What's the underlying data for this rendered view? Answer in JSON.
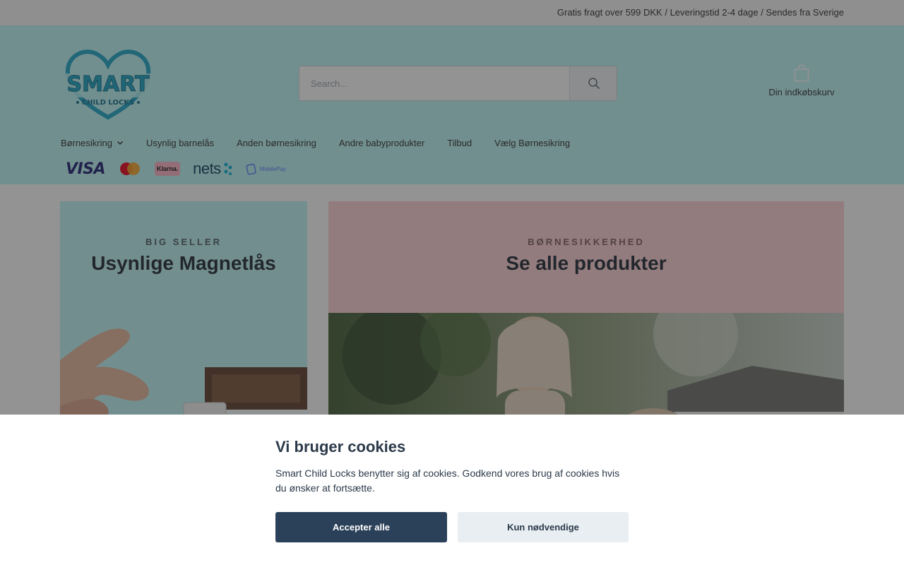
{
  "topbar": {
    "shipping_text": "Gratis fragt over 599 DKK / Leveringstid 2-4 dage / Sendes fra Sverige"
  },
  "header": {
    "logo": {
      "line1": "SMART",
      "line2": "CHILD LOCKS"
    },
    "search": {
      "placeholder": "Search..."
    },
    "cart": {
      "label": "Din indkøbskurv"
    }
  },
  "nav": {
    "items": [
      {
        "label": "Børnesikring",
        "has_dropdown": true
      },
      {
        "label": "Usynlig barnelås"
      },
      {
        "label": "Anden børnesikring"
      },
      {
        "label": "Andre babyprodukter"
      },
      {
        "label": "Tilbud"
      },
      {
        "label": "Vælg Børnesikring"
      }
    ]
  },
  "payments": {
    "visa": "VISA",
    "klarna": "Klarna.",
    "nets": "nets",
    "mobilepay": "MobilePay"
  },
  "cards": {
    "left": {
      "eyebrow": "BIG SELLER",
      "title": "Usynlige Magnetlås"
    },
    "right": {
      "eyebrow": "BØRNESIKKERHED",
      "title": "Se alle produkter"
    }
  },
  "cookie": {
    "title": "Vi bruger cookies",
    "text": "Smart Child Locks benytter sig af cookies. Godkend vores brug af cookies hvis du ønsker at fortsætte.",
    "accept_label": "Accepter alle",
    "necessary_label": "Kun nødvendige"
  },
  "colors": {
    "header_bg": "#bdf6f6",
    "left_card_bg": "#bef5f4",
    "right_card_bg": "#ffd0d4",
    "accept_button": "#2b4059",
    "necessary_button": "#e8eef2"
  }
}
